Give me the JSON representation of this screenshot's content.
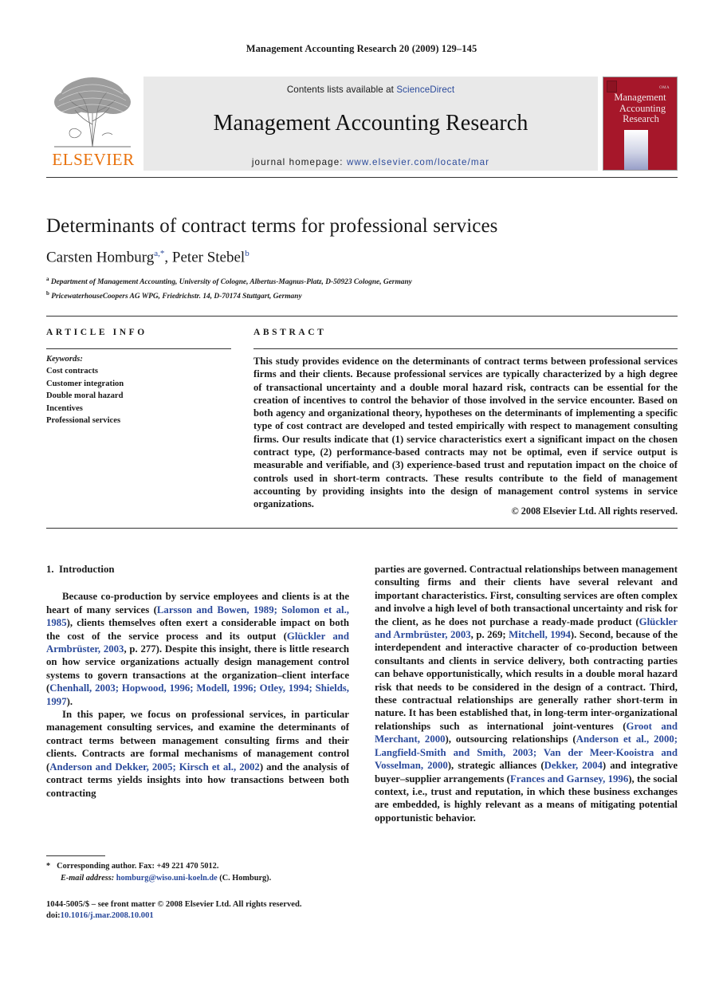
{
  "running_head": "Management Accounting Research 20 (2009) 129–145",
  "masthead": {
    "publisher": "ELSEVIER",
    "contents_prefix": "Contents lists available at ",
    "contents_link": "ScienceDirect",
    "journal_title": "Management Accounting Research",
    "homepage_label": "journal homepage:",
    "homepage_url": "www.elsevier.com/locate/mar",
    "cover": {
      "line1": "Management",
      "line2": "Accounting",
      "line3": "Research",
      "badge": "OMA"
    }
  },
  "article": {
    "title": "Determinants of contract terms for professional services",
    "authors": "Carsten Homburg",
    "author1_sup": "a,",
    "author1_star": "*",
    "authors2": ", Peter Stebel",
    "author2_sup": "b",
    "affiliation_a_marker": "a",
    "affiliation_a": "Department of Management Accounting, University of Cologne, Albertus-Magnus-Platz, D-50923 Cologne, Germany",
    "affiliation_b_marker": "b",
    "affiliation_b": "PricewaterhouseCoopers AG WPG, Friedrichstr. 14, D-70174 Stuttgart, Germany"
  },
  "info": {
    "heading": "ARTICLE INFO",
    "keywords_label": "Keywords:",
    "keywords": [
      "Cost contracts",
      "Customer integration",
      "Double moral hazard",
      "Incentives",
      "Professional services"
    ]
  },
  "abstract": {
    "heading": "ABSTRACT",
    "text": "This study provides evidence on the determinants of contract terms between professional services firms and their clients. Because professional services are typically characterized by a high degree of transactional uncertainty and a double moral hazard risk, contracts can be essential for the creation of incentives to control the behavior of those involved in the service encounter. Based on both agency and organizational theory, hypotheses on the determinants of implementing a specific type of cost contract are developed and tested empirically with respect to management consulting firms. Our results indicate that (1) service characteristics exert a significant impact on the chosen contract type, (2) performance-based contracts may not be optimal, even if service output is measurable and verifiable, and (3) experience-based trust and reputation impact on the choice of controls used in short-term contracts. These results contribute to the field of management accounting by providing insights into the design of management control systems in service organizations.",
    "copyright": "© 2008 Elsevier Ltd. All rights reserved."
  },
  "body": {
    "section_number": "1.",
    "section_title": "Introduction",
    "left_p1_a": "Because co-production by service employees and clients is at the heart of many services (",
    "left_p1_cite1": "Larsson and Bowen, 1989; Solomon et al., 1985",
    "left_p1_b": "), clients themselves often exert a considerable impact on both the cost of the service process and its output (",
    "left_p1_cite2": "Glückler and Armbrüster, 2003",
    "left_p1_c": ", p. 277). Despite this insight, there is little research on how service organizations actually design management control systems to govern transactions at the organization–client interface (",
    "left_p1_cite3": "Chenhall, 2003; Hopwood, 1996; Modell, 1996; Otley, 1994; Shields, 1997",
    "left_p1_d": ").",
    "left_p2_a": "In this paper, we focus on professional services, in particular management consulting services, and examine the determinants of contract terms between management consulting firms and their clients. Contracts are formal mechanisms of management control (",
    "left_p2_cite1": "Anderson and Dekker, 2005; Kirsch et al., 2002",
    "left_p2_b": ") and the analysis of contract terms yields insights into how transactions between both contracting",
    "right_a": "parties are governed. Contractual relationships between management consulting firms and their clients have several relevant and important characteristics. First, consulting services are often complex and involve a high level of both transactional uncertainty and risk for the client, as he does not purchase a ready-made product (",
    "right_cite1": "Glückler and Armbrüster, 2003",
    "right_b": ", p. 269; ",
    "right_cite2": "Mitchell, 1994",
    "right_c": "). Second, because of the interdependent and interactive character of co-production between consultants and clients in service delivery, both contracting parties can behave opportunistically, which results in a double moral hazard risk that needs to be considered in the design of a contract. Third, these contractual relationships are generally rather short-term in nature. It has been established that, in long-term inter-organizational relationships such as international joint-ventures (",
    "right_cite3": "Groot and Merchant, 2000",
    "right_d": "), outsourcing relationships (",
    "right_cite4": "Anderson et al., 2000; Langfield-Smith and Smith, 2003; Van der Meer-Kooistra and Vosselman, 2000",
    "right_e": "), strategic alliances (",
    "right_cite5": "Dekker, 2004",
    "right_f": ") and integrative buyer–supplier arrangements (",
    "right_cite6": "Frances and Garnsey, 1996",
    "right_g": "), the social context, i.e., trust and reputation, in which these business exchanges are embedded, is highly relevant as a means of mitigating potential opportunistic behavior."
  },
  "footnote": {
    "star": "*",
    "corresponding": "Corresponding author. Fax: +49 221 470 5012.",
    "email_label": "E-mail address:",
    "email": "homburg@wiso.uni-koeln.de",
    "email_suffix": " (C. Homburg)."
  },
  "frontmatter": {
    "line1": "1044-5005/$ – see front matter © 2008 Elsevier Ltd. All rights reserved.",
    "doi_label": "doi:",
    "doi": "10.1016/j.mar.2008.10.001"
  },
  "colors": {
    "link": "#2b4a9b",
    "elsevier_orange": "#E8700A",
    "cover_red": "#A6172A",
    "banner_gray": "#e9e9e9"
  }
}
